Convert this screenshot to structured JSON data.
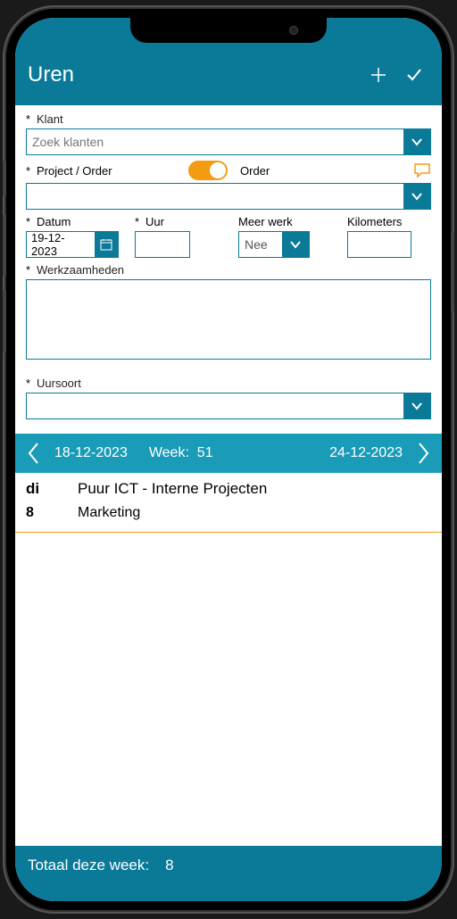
{
  "header": {
    "title": "Uren"
  },
  "form": {
    "klant": {
      "label": "Klant",
      "placeholder": "Zoek klanten",
      "required": true
    },
    "project": {
      "label": "Project / Order",
      "toggle_label": "Order",
      "required": true
    },
    "datum": {
      "label": "Datum",
      "value": "19-12-2023",
      "required": true
    },
    "uur": {
      "label": "Uur",
      "required": true
    },
    "meerwerk": {
      "label": "Meer werk",
      "value": "Nee"
    },
    "kilometers": {
      "label": "Kilometers"
    },
    "werkzaamheden": {
      "label": "Werkzaamheden",
      "required": true
    },
    "uursoort": {
      "label": "Uursoort",
      "required": true
    }
  },
  "weekNav": {
    "start": "18-12-2023",
    "week_label": "Week:",
    "week_num": "51",
    "end": "24-12-2023"
  },
  "entries": [
    {
      "day": "di",
      "client": "Puur ICT - Interne Projecten",
      "hours": "8",
      "activity": "Marketing"
    }
  ],
  "footer": {
    "label": "Totaal deze week:",
    "value": "8"
  }
}
